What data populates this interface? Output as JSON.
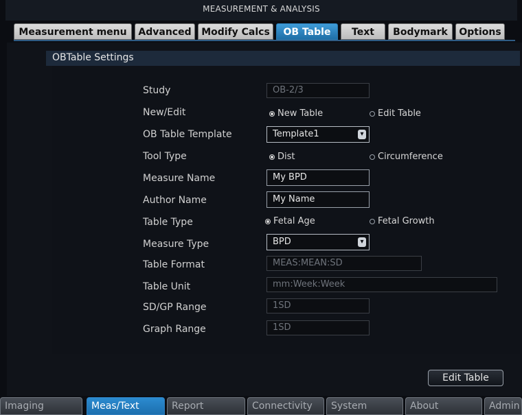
{
  "window": {
    "title": "MEASUREMENT & ANALYSIS"
  },
  "tabs": [
    {
      "label": "Measurement menu",
      "active": false
    },
    {
      "label": "Advanced",
      "active": false
    },
    {
      "label": "Modify Calcs",
      "active": false
    },
    {
      "label": "OB Table",
      "active": true
    },
    {
      "label": "Text",
      "active": false
    },
    {
      "label": "Bodymark",
      "active": false
    },
    {
      "label": "Options",
      "active": false
    }
  ],
  "section": {
    "title": "OBTable Settings"
  },
  "form": {
    "study": {
      "label": "Study",
      "value": "OB-2/3"
    },
    "new_edit": {
      "label": "New/Edit",
      "option_new": "New Table",
      "option_edit": "Edit Table",
      "selected": "New Table"
    },
    "template": {
      "label": "OB Table Template",
      "value": "Template1"
    },
    "tool_type": {
      "label": "Tool Type",
      "option_dist": "Dist",
      "option_circ": "Circumference",
      "selected": "Dist"
    },
    "measure_name": {
      "label": "Measure Name",
      "value": "My BPD"
    },
    "author_name": {
      "label": "Author Name",
      "value": "My Name"
    },
    "table_type": {
      "label": "Table Type",
      "option_fetal_age": "Fetal Age",
      "option_fetal_growth": "Fetal Growth",
      "selected": "Fetal Age"
    },
    "measure_type": {
      "label": "Measure Type",
      "value": "BPD"
    },
    "table_format": {
      "label": "Table Format",
      "value": "MEAS:MEAN:SD"
    },
    "table_unit": {
      "label": "Table Unit",
      "value": "mm:Week:Week"
    },
    "sdgp_range": {
      "label": "SD/GP Range",
      "value": "1SD"
    },
    "graph_range": {
      "label": "Graph Range",
      "value": "1SD"
    }
  },
  "actions": {
    "edit_table": "Edit Table"
  },
  "bottom_tabs": [
    {
      "label": "Imaging",
      "active": false
    },
    {
      "label": "Meas/Text",
      "active": true
    },
    {
      "label": "Report",
      "active": false
    },
    {
      "label": "Connectivity",
      "active": false
    },
    {
      "label": "System",
      "active": false
    },
    {
      "label": "About",
      "active": false
    },
    {
      "label": "Admin",
      "active": false
    }
  ]
}
